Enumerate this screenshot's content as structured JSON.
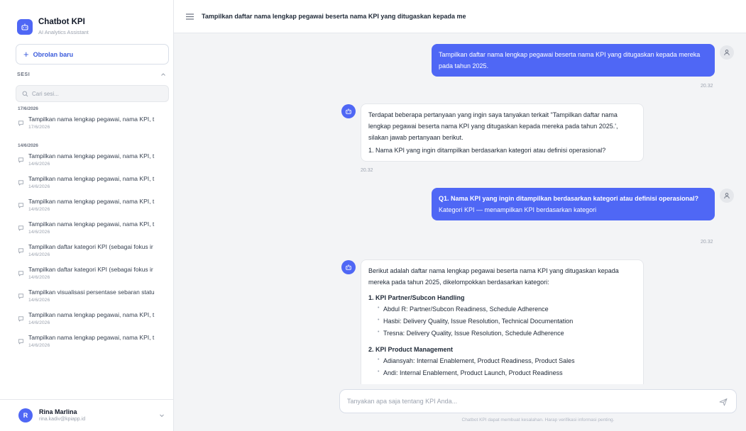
{
  "app": {
    "name": "Chatbot KPI",
    "subtitle": "AI Analytics Assistant",
    "accent": "#4f67f5"
  },
  "sidebar": {
    "new_chat_label": "Obrolan baru",
    "section_label": "SESI",
    "search_placeholder": "Cari sesi...",
    "groups": [
      {
        "date": "17/6/2026",
        "items": [
          {
            "title": "Tampilkan nama lengkap pegawai, nama KPI, t",
            "date": "17/6/2026"
          }
        ]
      },
      {
        "date": "14/6/2026",
        "items": [
          {
            "title": "Tampilkan nama lengkap pegawai, nama KPI, t",
            "date": "14/6/2026"
          },
          {
            "title": "Tampilkan nama lengkap pegawai, nama KPI, t",
            "date": "14/6/2026"
          },
          {
            "title": "Tampilkan nama lengkap pegawai, nama KPI, t",
            "date": "14/6/2026"
          },
          {
            "title": "Tampilkan nama lengkap pegawai, nama KPI, t",
            "date": "14/6/2026"
          },
          {
            "title": "Tampilkan daftar kategori KPI (sebagai fokus ir",
            "date": "14/6/2026"
          },
          {
            "title": "Tampilkan daftar kategori KPI (sebagai fokus ir",
            "date": "14/6/2026"
          },
          {
            "title": "Tampilkan visualisasi persentase sebaran statu",
            "date": "14/6/2026"
          },
          {
            "title": "Tampilkan nama lengkap pegawai, nama KPI, t",
            "date": "14/6/2026"
          },
          {
            "title": "Tampilkan nama lengkap pegawai, nama KPI, t",
            "date": "14/6/2026"
          }
        ]
      }
    ],
    "user": {
      "initial": "R",
      "name": "Rina Marlina",
      "email": "rina.kadiv@kpiapp.id"
    }
  },
  "header": {
    "title": "Tampilkan daftar nama lengkap pegawai beserta nama KPI yang ditugaskan kepada me"
  },
  "messages": {
    "m1": {
      "role": "user",
      "text": "Tampilkan daftar nama lengkap pegawai beserta nama KPI yang ditugaskan kepada mereka pada tahun 2025.",
      "time": "20.32"
    },
    "m2": {
      "role": "assistant",
      "intro": "Terdapat beberapa pertanyaan yang ingin saya tanyakan terkait \"Tampilkan daftar nama lengkap pegawai beserta nama KPI yang ditugaskan kepada mereka pada tahun 2025.', silakan jawab pertanyaan berikut.",
      "question": "1. Nama KPI yang ingin ditampilkan berdasarkan kategori atau definisi operasional?",
      "time": "20.32"
    },
    "m3": {
      "role": "user",
      "question": "Q1. Nama KPI yang ingin ditampilkan berdasarkan kategori atau definisi operasional?",
      "answer": "Kategori KPI — menampilkan KPI berdasarkan kategori",
      "time": "20.32"
    },
    "m4": {
      "role": "assistant",
      "intro": "Berikut adalah daftar nama lengkap pegawai beserta nama KPI yang ditugaskan kepada mereka pada tahun 2025, dikelompokkan berdasarkan kategori:",
      "categories": [
        {
          "num": "1.",
          "name": "KPI Partner/Subcon Handling",
          "items": [
            "Abdul R: Partner/Subcon Readiness, Schedule Adherence",
            "Hasbi: Delivery Quality, Issue Resolution, Technical Documentation",
            "Tresna: Delivery Quality, Issue Resolution, Schedule Adherence"
          ]
        },
        {
          "num": "2.",
          "name": "KPI Product Management",
          "items": [
            "Adiansyah: Internal Enablement, Product Readiness, Product Sales",
            "Andi: Internal Enablement, Product Launch, Product Readiness"
          ]
        }
      ]
    }
  },
  "composer": {
    "placeholder": "Tanyakan apa saja tentang KPI Anda...",
    "disclaimer": "Chatbot KPI dapat membuat kesalahan. Harap verifikasi informasi penting."
  }
}
